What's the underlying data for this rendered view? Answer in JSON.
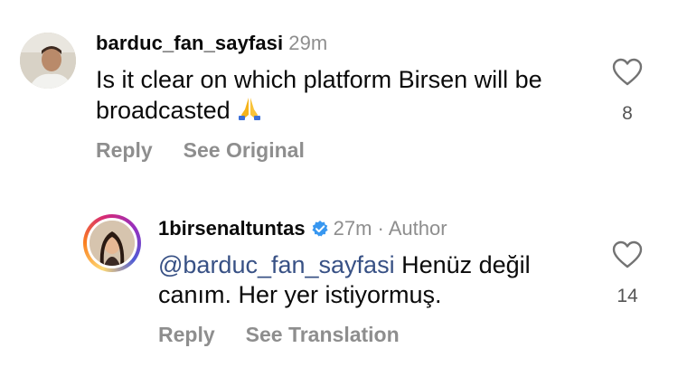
{
  "comments": [
    {
      "username": "barduc_fan_sayfasi",
      "time": "29m",
      "text": "Is it clear on which platform Birsen will be broadcasted",
      "emoji": "folded-hands",
      "actions": {
        "reply": "Reply",
        "secondary": "See Original"
      },
      "likes": "8"
    },
    {
      "username": "1birsenaltuntas",
      "verified": true,
      "time_meta": "27m · Author",
      "mention": "@barduc_fan_sayfasi",
      "text": " Henüz değil canım. Her yer istiyormuş.",
      "actions": {
        "reply": "Reply",
        "secondary": "See Translation"
      },
      "likes": "14"
    }
  ],
  "colors": {
    "secondary_text": "#8e8e8e",
    "mention": "#385185",
    "verified": "#3897f0"
  }
}
